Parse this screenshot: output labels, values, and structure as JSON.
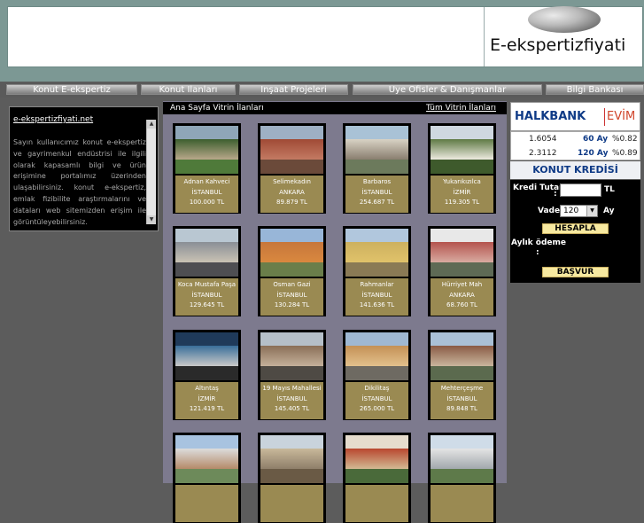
{
  "brand": {
    "name": "E-ekspertizfiyati"
  },
  "nav": {
    "items": [
      "Konut E-ekspertiz",
      "Konut İlanları",
      "İnşaat Projeleri",
      "Üye Ofisler & Danışmanlar",
      "Bilgi Bankası"
    ]
  },
  "left_panel": {
    "title": "e-ekspertizfiyati.net",
    "text": "Sayın kullanıcımız konut e-ekspertiz ve gayrimenkul endüstrisi ile ilgili olarak kapasamlı bilgi ve ürün erişimine portalımız üzerinden ulaşabilirsiniz. konut e-ekspertiz, emlak fizibilite araştırmalarını ve dataları web sitemizden erişim ile görüntüleyebilirsiniz."
  },
  "center": {
    "heading": "Ana Sayfa Vitrin İlanları",
    "all_link": "Tüm Vitrin İlanları",
    "listings": [
      {
        "name": "Adnan Kahveci",
        "city": "İSTANBUL",
        "price": "100.000 TL"
      },
      {
        "name": "Selimekadın",
        "city": "ANKARA",
        "price": "89.879 TL"
      },
      {
        "name": "Barbaros",
        "city": "İSTANBUL",
        "price": "254.687 TL"
      },
      {
        "name": "Yukarıkızılca",
        "city": "İZMİR",
        "price": "119.305 TL"
      },
      {
        "name": "Koca Mustafa Paşa",
        "city": "İSTANBUL",
        "price": "129.645 TL"
      },
      {
        "name": "Osman Gazi",
        "city": "İSTANBUL",
        "price": "130.284 TL"
      },
      {
        "name": "Rahmanlar",
        "city": "İSTANBUL",
        "price": "141.636 TL"
      },
      {
        "name": "Hürriyet Mah",
        "city": "ANKARA",
        "price": "68.760 TL"
      },
      {
        "name": "Altıntaş",
        "city": "İZMİR",
        "price": "121.419 TL"
      },
      {
        "name": "19 Mayıs Mahallesi",
        "city": "İSTANBUL",
        "price": "145.405 TL"
      },
      {
        "name": "Dikilitaş",
        "city": "İSTANBUL",
        "price": "265.000 TL"
      },
      {
        "name": "Mehterçeşme",
        "city": "İSTANBUL",
        "price": "89.848 TL"
      },
      {
        "name": "",
        "city": "",
        "price": ""
      },
      {
        "name": "",
        "city": "",
        "price": ""
      },
      {
        "name": "",
        "city": "",
        "price": ""
      },
      {
        "name": "",
        "city": "",
        "price": ""
      }
    ]
  },
  "right_panel": {
    "bank_name": "HALKBANK",
    "bank_product": "EVİM",
    "rates": [
      {
        "value": "1.6054",
        "term": "60 Ay",
        "rate": "%0.82"
      },
      {
        "value": "2.3112",
        "term": "120 Ay",
        "rate": "%0.89"
      }
    ],
    "calc_title": "KONUT KREDİSİ HESAPLA",
    "amount_label": "Kredi Tutarı",
    "amount_value": "",
    "currency": "TL",
    "term_label": "Vade",
    "term_value": "120",
    "term_unit": "Ay",
    "calc_button": "HESAPLA",
    "monthly_label": "Aylık ödeme",
    "colon": ":",
    "apply_button": "BAŞVUR"
  },
  "colors": {
    "bank_blue": "#0e3a86",
    "bank_red": "#d0452b",
    "card_info": "#9a8a52"
  }
}
